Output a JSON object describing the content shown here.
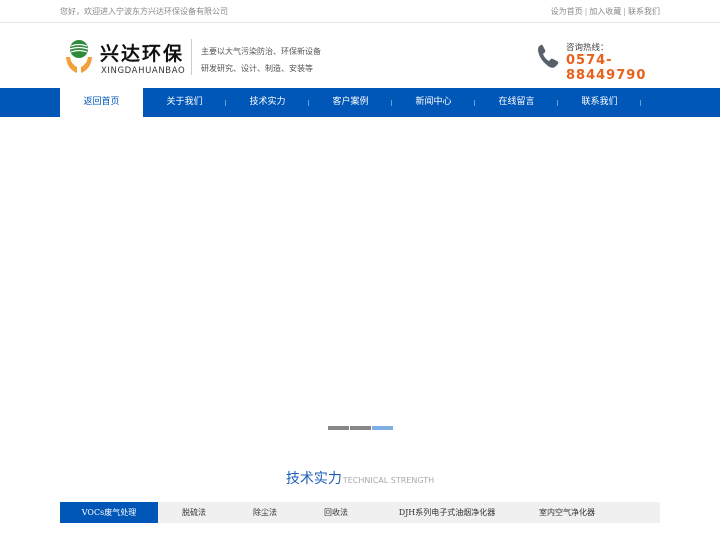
{
  "topbar": {
    "welcome": "您好，欢迎进入宁波东方兴达环保设备有限公司",
    "links": [
      "设为首页",
      "加入收藏",
      "联系我们"
    ],
    "separator": "|"
  },
  "logo": {
    "name_cn": "兴达环保",
    "name_en": "XINGDAHUANBAO"
  },
  "slogan": {
    "line1": "主要以大气污染防治、环保新设备",
    "line2": "研发研究、设计、制造、安装等"
  },
  "hotline": {
    "label": "咨询热线：",
    "number": "0574-88449790"
  },
  "nav": {
    "items": [
      {
        "label": "返回首页",
        "active": true
      },
      {
        "label": "关于我们"
      },
      {
        "label": "技术实力"
      },
      {
        "label": "客户案例"
      },
      {
        "label": "新闻中心"
      },
      {
        "label": "在线留言"
      },
      {
        "label": "联系我们"
      }
    ]
  },
  "banner": {
    "slide_count": 3,
    "active_slide": 3
  },
  "section": {
    "title_cn": "技术实力",
    "title_en": "TECHNICAL STRENGTH"
  },
  "tabs": {
    "items": [
      {
        "label": "VOCs废气处理",
        "active": true
      },
      {
        "label": "脱硫法"
      },
      {
        "label": "除尘法"
      },
      {
        "label": "回收法"
      },
      {
        "label": "DJH系列电子式油烟净化器"
      },
      {
        "label": "室内空气净化器"
      }
    ]
  },
  "colors": {
    "brand_blue": "#0057b7",
    "hotline_orange": "#e8601c",
    "logo_green": "#2e8b3a",
    "logo_orange": "#f2a03a"
  }
}
